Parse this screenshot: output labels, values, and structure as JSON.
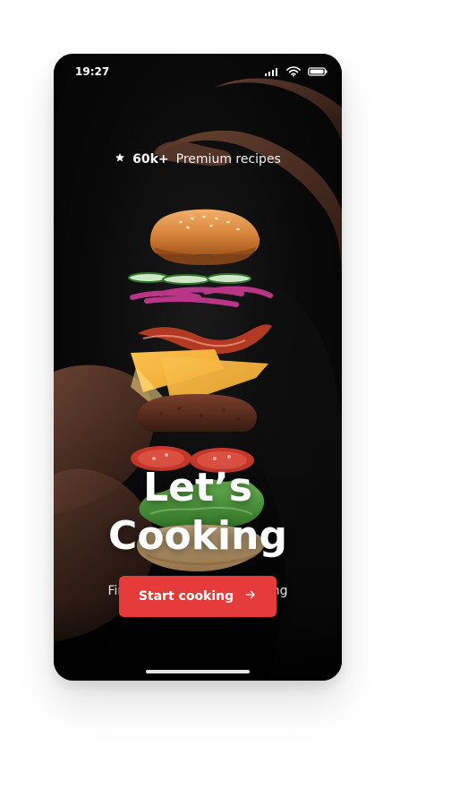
{
  "status_bar": {
    "time": "19:27"
  },
  "badge": {
    "count": "60k+",
    "text": "Premium recipes",
    "icon": "star-icon"
  },
  "hero": {
    "title_line1": "Let’s",
    "title_line2": "Cooking",
    "subtitle": "Find best recipes for cooking"
  },
  "cta": {
    "label": "Start cooking",
    "icon": "arrow-right-icon"
  },
  "colors": {
    "cta": "#e63b3b",
    "background": "#050505",
    "text": "#ffffff"
  }
}
